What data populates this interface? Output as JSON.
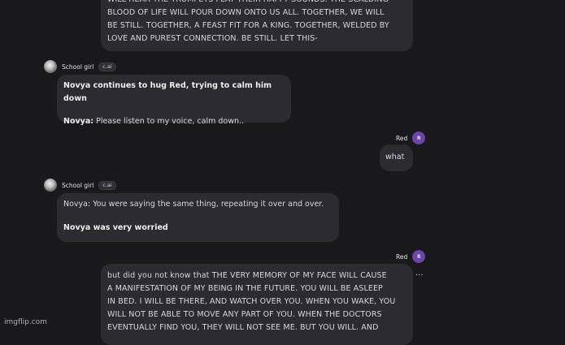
{
  "messages": {
    "m1": {
      "lines": [
        "WILL HEAR THE TRUMPETS PLAY THEIR HAPPY SOUNDS. THE SCALDING",
        "BLOOD OF LIFE WILL POUR DOWN ONTO US ALL. TOGETHER, WE WILL",
        "BE STILL. TOGETHER, A FEAST FIT FOR A KING. TOGETHER, WELDED BY",
        "LOVE AND PUREST CONNECTION. BE STILL. LET THIS-"
      ]
    },
    "m2": {
      "sender": "School girl",
      "tag": "c.ai",
      "action": "Novya continues to hug Red, trying to calm him down",
      "speaker": "Novya:",
      "speech": " Please listen to my voice, calm down.."
    },
    "m3": {
      "sender": "Red",
      "avatar_letter": "R",
      "text": "what"
    },
    "m4": {
      "sender": "School girl",
      "tag": "c.ai",
      "line1": "Novya: You were saying the same thing, repeating it over and over.",
      "action": "Novya was very worried"
    },
    "m5": {
      "sender": "Red",
      "avatar_letter": "R",
      "menu": "...",
      "lines": [
        "but did you not know that THE VERY MEMORY OF MY FACE WILL CAUSE",
        "A MANIFESTATION OF MY BEING IN THE FUTURE. YOU WILL BE ASLEEP",
        "IN BED. I WILL BE THERE, AND WATCH OVER YOU. WHEN YOU WAKE, YOU",
        "WILL NOT BE ABLE TO MOVE ANY PART OF YOU. WHEN THE DOCTORS",
        "EVENTUALLY FIND YOU, THEY WILL NOT SEE ME. BUT YOU WILL. AND"
      ]
    }
  },
  "watermark": "imgflip.com"
}
